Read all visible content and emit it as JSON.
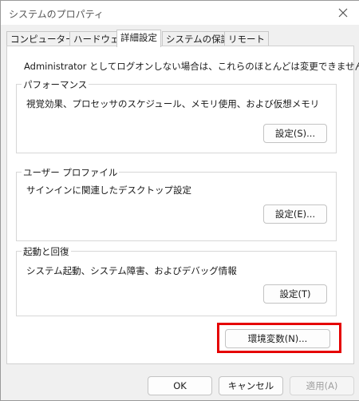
{
  "window": {
    "title": "システムのプロパティ"
  },
  "tabs": [
    {
      "label": "コンピューター名"
    },
    {
      "label": "ハードウェア"
    },
    {
      "label": "詳細設定"
    },
    {
      "label": "システムの保護"
    },
    {
      "label": "リモート"
    }
  ],
  "panel": {
    "admin_note": "Administrator としてログオンしない場合は、これらのほとんどは変更できません。",
    "performance": {
      "label": "パフォーマンス",
      "description": "視覚効果、プロセッサのスケジュール、メモリ使用、および仮想メモリ",
      "button": "設定(S)..."
    },
    "user_profile": {
      "label": "ユーザー プロファイル",
      "description": "サインインに関連したデスクトップ設定",
      "button": "設定(E)..."
    },
    "startup_recovery": {
      "label": "起動と回復",
      "description": "システム起動、システム障害、およびデバッグ情報",
      "button": "設定(T)"
    },
    "env_vars_button": "環境変数(N)..."
  },
  "footer": {
    "ok": "OK",
    "cancel": "キャンセル",
    "apply": "適用(A)"
  },
  "colors": {
    "highlight": "#e50000"
  },
  "icons": {
    "close": "close-icon"
  }
}
